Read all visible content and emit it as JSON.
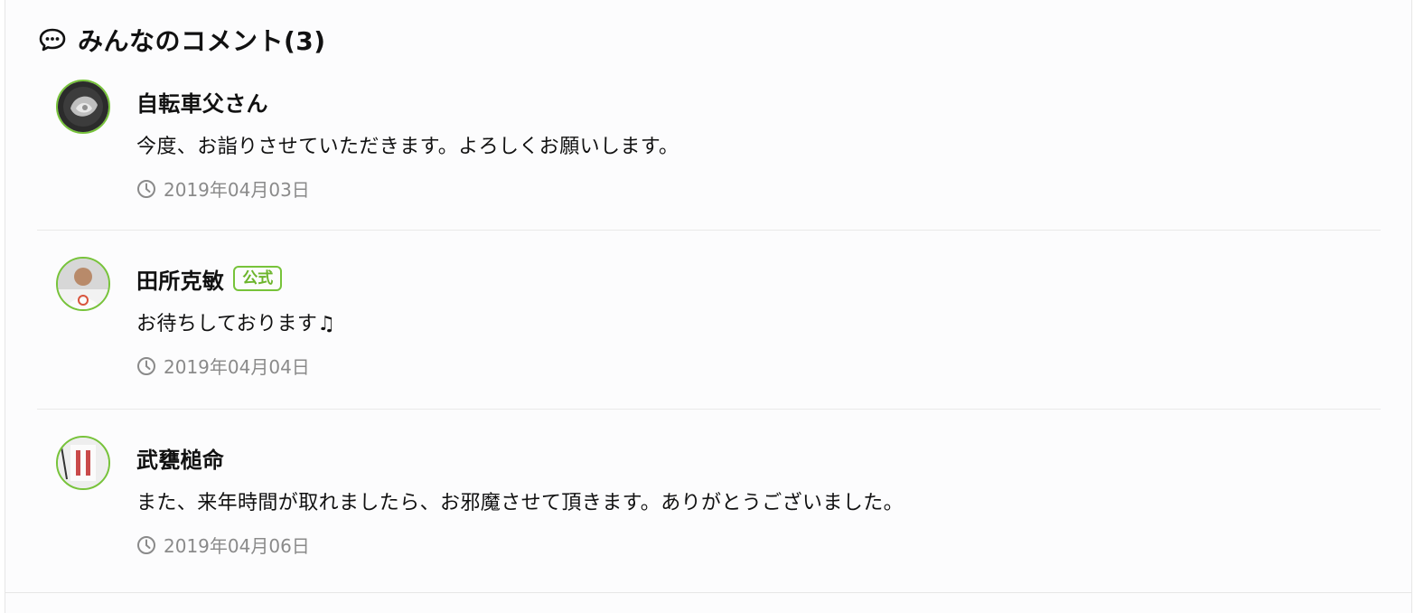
{
  "section": {
    "title": "みんなのコメント(3)",
    "icon": "comment-bubble-icon"
  },
  "colors": {
    "accent": "#77c33a",
    "badge_text": "#6cb52c",
    "meta_text": "#8a8a8a",
    "divider": "#e9e9e9"
  },
  "comments": [
    {
      "name": "自転車父さん",
      "official": false,
      "badge": "",
      "text": "今度、お詣りさせていただきます。よろしくお願いします。",
      "date": "2019年04月03日"
    },
    {
      "name": "田所克敏",
      "official": true,
      "badge": "公式",
      "text": "お待ちしております♫",
      "date": "2019年04月04日"
    },
    {
      "name": "武甕槌命",
      "official": false,
      "badge": "",
      "text": "また、来年時間が取れましたら、お邪魔させて頂きます。ありがとうございました。",
      "date": "2019年04月06日"
    }
  ]
}
